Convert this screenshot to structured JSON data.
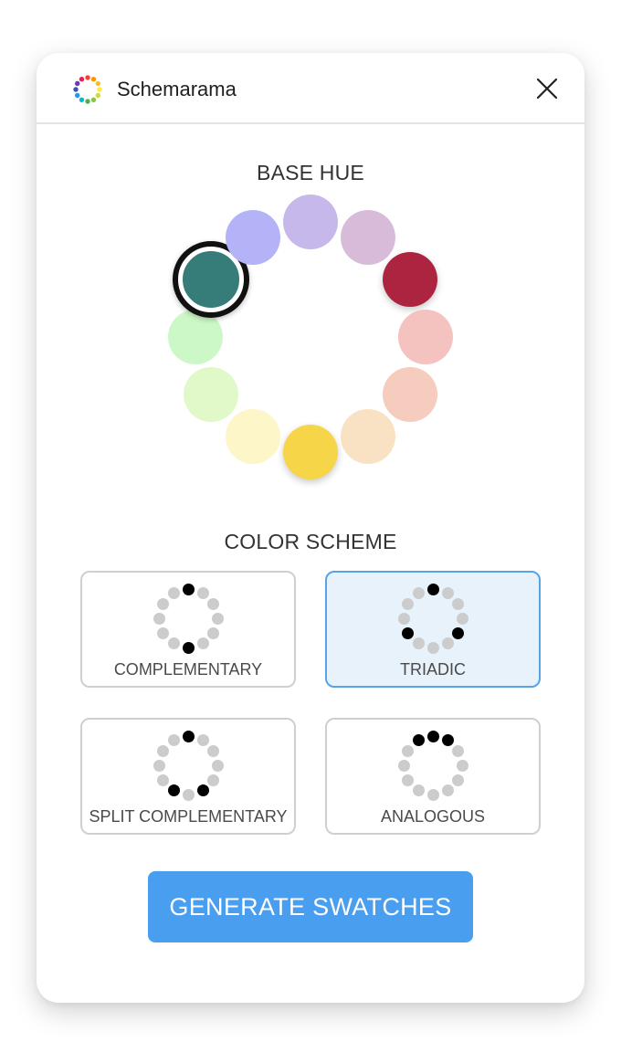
{
  "app": {
    "title": "Schemarama",
    "logo_icon": "color-wheel-logo-icon",
    "close_icon": "close-icon"
  },
  "base_hue": {
    "title": "BASE HUE",
    "selected_index": 10,
    "swatches": [
      {
        "name": "lavender",
        "color": "#c7b8eb",
        "vivid": false
      },
      {
        "name": "orchid",
        "color": "#d8bbd9",
        "vivid": false
      },
      {
        "name": "crimson",
        "color": "#ad2441",
        "vivid": true
      },
      {
        "name": "salmon",
        "color": "#f4c3c0",
        "vivid": false
      },
      {
        "name": "peach",
        "color": "#f6ccbe",
        "vivid": false
      },
      {
        "name": "apricot",
        "color": "#f8e2c3",
        "vivid": false
      },
      {
        "name": "gold",
        "color": "#f7d548",
        "vivid": true
      },
      {
        "name": "cream-yellow",
        "color": "#fcf6c9",
        "vivid": false
      },
      {
        "name": "lime",
        "color": "#e1f9c8",
        "vivid": false
      },
      {
        "name": "mint",
        "color": "#ccf8c8",
        "vivid": false
      },
      {
        "name": "teal",
        "color": "#367c79",
        "vivid": true
      },
      {
        "name": "periwinkle",
        "color": "#b4b3f7",
        "vivid": false
      }
    ]
  },
  "color_scheme": {
    "title": "COLOR SCHEME",
    "selected": "triadic",
    "options": [
      {
        "id": "complementary",
        "label": "COMPLEMENTARY",
        "active_dots": [
          0,
          6
        ]
      },
      {
        "id": "triadic",
        "label": "TRIADIC",
        "active_dots": [
          0,
          4,
          8
        ]
      },
      {
        "id": "split-complementary",
        "label": "SPLIT COMPLEMENTARY",
        "active_dots": [
          0,
          5,
          7
        ]
      },
      {
        "id": "analogous",
        "label": "ANALOGOUS",
        "active_dots": [
          11,
          0,
          1
        ]
      }
    ]
  },
  "actions": {
    "generate_label": "GENERATE SWATCHES"
  },
  "colors": {
    "accent": "#4a9ef0",
    "selected_card_bg": "#e8f2fb",
    "selected_card_border": "#56a4e8",
    "inactive_dot": "#cccccc",
    "active_dot": "#000000"
  }
}
